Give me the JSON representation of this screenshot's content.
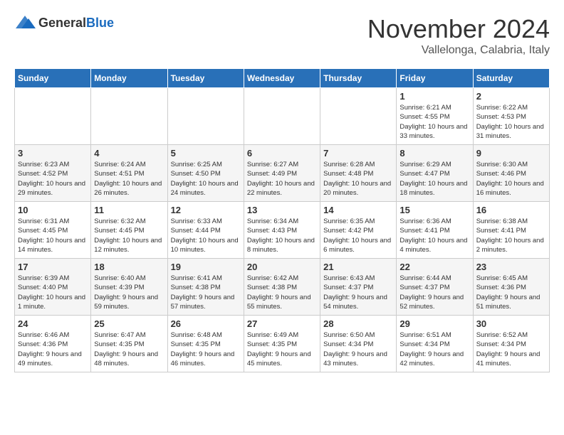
{
  "header": {
    "logo_general": "General",
    "logo_blue": "Blue",
    "title": "November 2024",
    "subtitle": "Vallelonga, Calabria, Italy"
  },
  "days_of_week": [
    "Sunday",
    "Monday",
    "Tuesday",
    "Wednesday",
    "Thursday",
    "Friday",
    "Saturday"
  ],
  "weeks": [
    [
      {
        "day": "",
        "info": ""
      },
      {
        "day": "",
        "info": ""
      },
      {
        "day": "",
        "info": ""
      },
      {
        "day": "",
        "info": ""
      },
      {
        "day": "",
        "info": ""
      },
      {
        "day": "1",
        "info": "Sunrise: 6:21 AM\nSunset: 4:55 PM\nDaylight: 10 hours and 33 minutes."
      },
      {
        "day": "2",
        "info": "Sunrise: 6:22 AM\nSunset: 4:53 PM\nDaylight: 10 hours and 31 minutes."
      }
    ],
    [
      {
        "day": "3",
        "info": "Sunrise: 6:23 AM\nSunset: 4:52 PM\nDaylight: 10 hours and 29 minutes."
      },
      {
        "day": "4",
        "info": "Sunrise: 6:24 AM\nSunset: 4:51 PM\nDaylight: 10 hours and 26 minutes."
      },
      {
        "day": "5",
        "info": "Sunrise: 6:25 AM\nSunset: 4:50 PM\nDaylight: 10 hours and 24 minutes."
      },
      {
        "day": "6",
        "info": "Sunrise: 6:27 AM\nSunset: 4:49 PM\nDaylight: 10 hours and 22 minutes."
      },
      {
        "day": "7",
        "info": "Sunrise: 6:28 AM\nSunset: 4:48 PM\nDaylight: 10 hours and 20 minutes."
      },
      {
        "day": "8",
        "info": "Sunrise: 6:29 AM\nSunset: 4:47 PM\nDaylight: 10 hours and 18 minutes."
      },
      {
        "day": "9",
        "info": "Sunrise: 6:30 AM\nSunset: 4:46 PM\nDaylight: 10 hours and 16 minutes."
      }
    ],
    [
      {
        "day": "10",
        "info": "Sunrise: 6:31 AM\nSunset: 4:45 PM\nDaylight: 10 hours and 14 minutes."
      },
      {
        "day": "11",
        "info": "Sunrise: 6:32 AM\nSunset: 4:45 PM\nDaylight: 10 hours and 12 minutes."
      },
      {
        "day": "12",
        "info": "Sunrise: 6:33 AM\nSunset: 4:44 PM\nDaylight: 10 hours and 10 minutes."
      },
      {
        "day": "13",
        "info": "Sunrise: 6:34 AM\nSunset: 4:43 PM\nDaylight: 10 hours and 8 minutes."
      },
      {
        "day": "14",
        "info": "Sunrise: 6:35 AM\nSunset: 4:42 PM\nDaylight: 10 hours and 6 minutes."
      },
      {
        "day": "15",
        "info": "Sunrise: 6:36 AM\nSunset: 4:41 PM\nDaylight: 10 hours and 4 minutes."
      },
      {
        "day": "16",
        "info": "Sunrise: 6:38 AM\nSunset: 4:41 PM\nDaylight: 10 hours and 2 minutes."
      }
    ],
    [
      {
        "day": "17",
        "info": "Sunrise: 6:39 AM\nSunset: 4:40 PM\nDaylight: 10 hours and 1 minute."
      },
      {
        "day": "18",
        "info": "Sunrise: 6:40 AM\nSunset: 4:39 PM\nDaylight: 9 hours and 59 minutes."
      },
      {
        "day": "19",
        "info": "Sunrise: 6:41 AM\nSunset: 4:38 PM\nDaylight: 9 hours and 57 minutes."
      },
      {
        "day": "20",
        "info": "Sunrise: 6:42 AM\nSunset: 4:38 PM\nDaylight: 9 hours and 55 minutes."
      },
      {
        "day": "21",
        "info": "Sunrise: 6:43 AM\nSunset: 4:37 PM\nDaylight: 9 hours and 54 minutes."
      },
      {
        "day": "22",
        "info": "Sunrise: 6:44 AM\nSunset: 4:37 PM\nDaylight: 9 hours and 52 minutes."
      },
      {
        "day": "23",
        "info": "Sunrise: 6:45 AM\nSunset: 4:36 PM\nDaylight: 9 hours and 51 minutes."
      }
    ],
    [
      {
        "day": "24",
        "info": "Sunrise: 6:46 AM\nSunset: 4:36 PM\nDaylight: 9 hours and 49 minutes."
      },
      {
        "day": "25",
        "info": "Sunrise: 6:47 AM\nSunset: 4:35 PM\nDaylight: 9 hours and 48 minutes."
      },
      {
        "day": "26",
        "info": "Sunrise: 6:48 AM\nSunset: 4:35 PM\nDaylight: 9 hours and 46 minutes."
      },
      {
        "day": "27",
        "info": "Sunrise: 6:49 AM\nSunset: 4:35 PM\nDaylight: 9 hours and 45 minutes."
      },
      {
        "day": "28",
        "info": "Sunrise: 6:50 AM\nSunset: 4:34 PM\nDaylight: 9 hours and 43 minutes."
      },
      {
        "day": "29",
        "info": "Sunrise: 6:51 AM\nSunset: 4:34 PM\nDaylight: 9 hours and 42 minutes."
      },
      {
        "day": "30",
        "info": "Sunrise: 6:52 AM\nSunset: 4:34 PM\nDaylight: 9 hours and 41 minutes."
      }
    ]
  ]
}
